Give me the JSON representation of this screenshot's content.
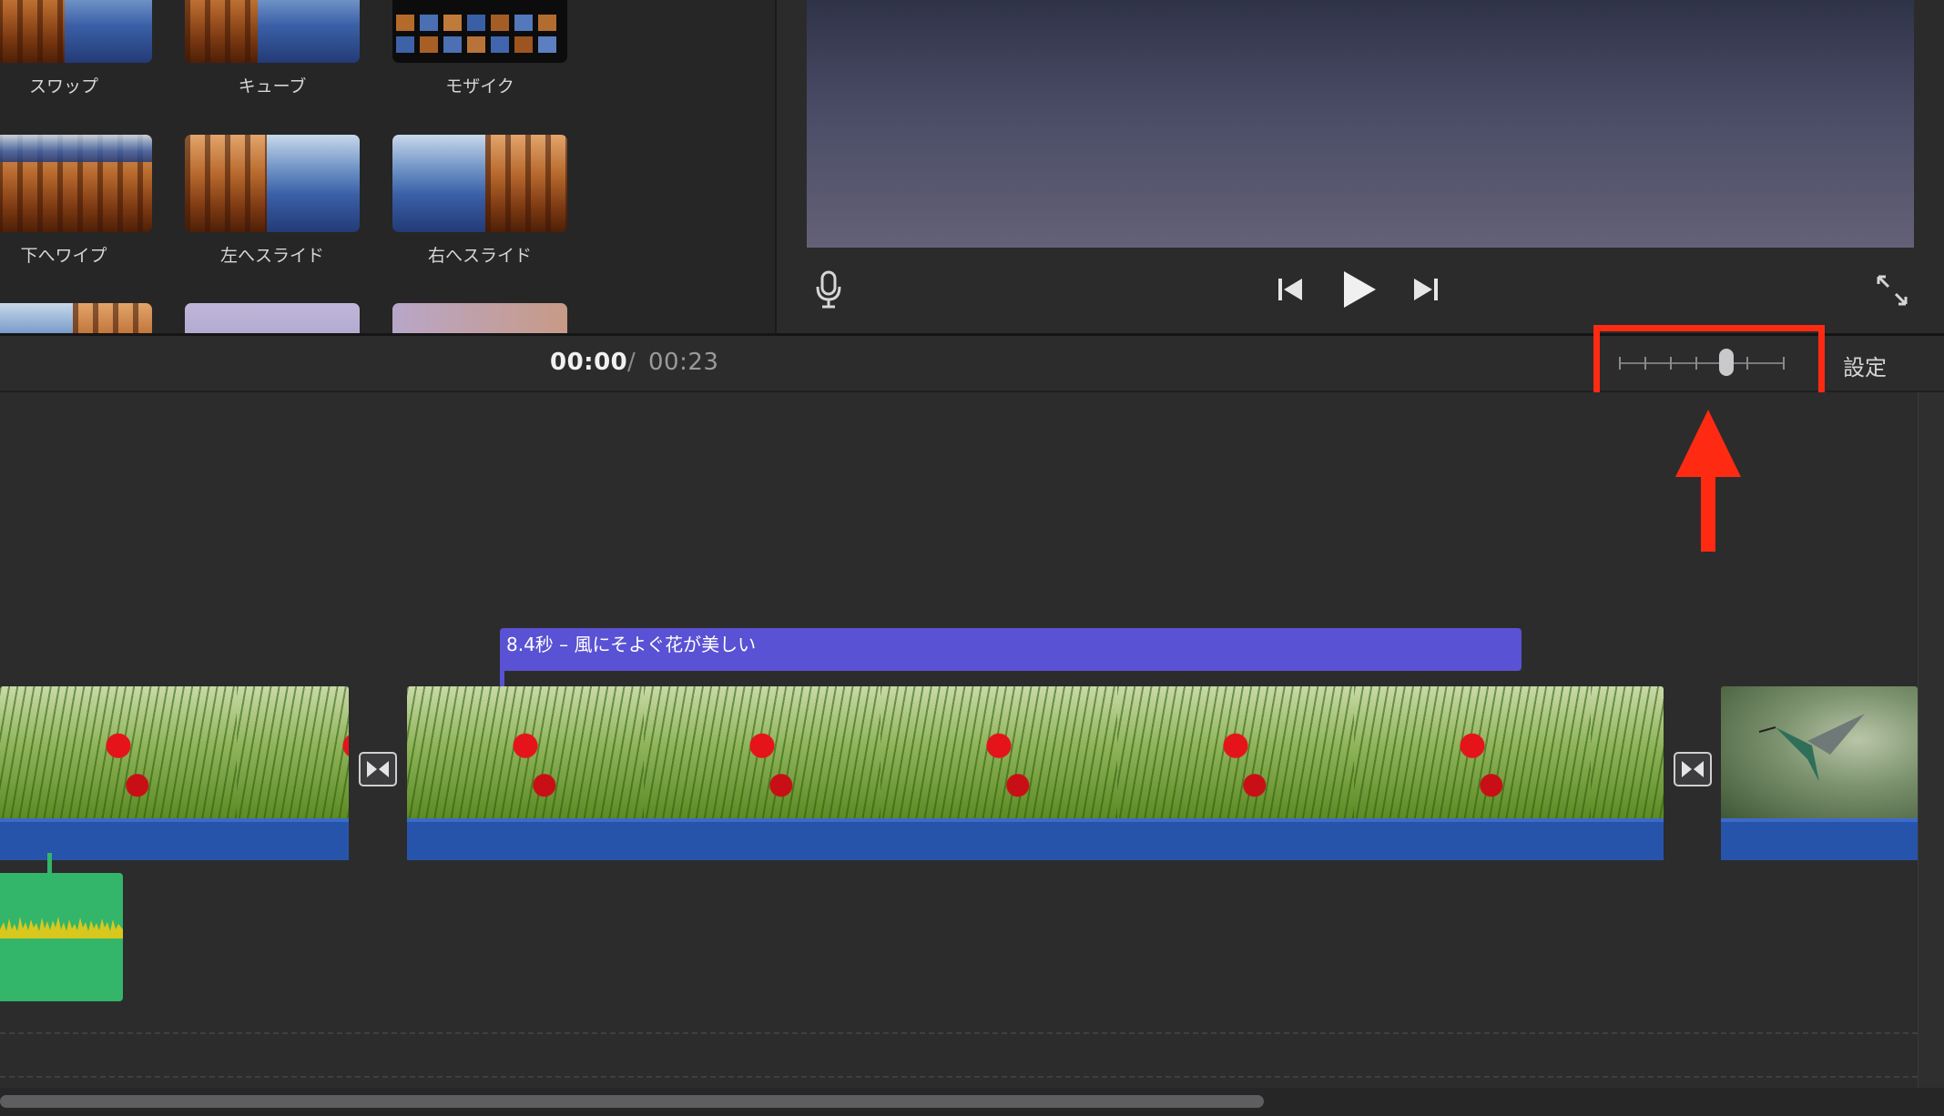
{
  "transitions": [
    {
      "label": "スワップ",
      "icon": "swap-transition-thumbnail"
    },
    {
      "label": "キューブ",
      "icon": "cube-transition-thumbnail"
    },
    {
      "label": "モザイク",
      "icon": "mosaic-transition-thumbnail"
    },
    {
      "label": "下へワイプ",
      "icon": "wipe-down-transition-thumbnail"
    },
    {
      "label": "左へスライド",
      "icon": "slide-left-transition-thumbnail"
    },
    {
      "label": "右へスライド",
      "icon": "slide-right-transition-thumbnail"
    }
  ],
  "viewer": {
    "controls": [
      "microphone-icon",
      "skip-back-icon",
      "play-icon",
      "skip-forward-icon",
      "fullscreen-icon"
    ]
  },
  "timecode": {
    "current": "00:00",
    "separator": "/",
    "total": "00:23"
  },
  "toolbar": {
    "settings_label": "設定",
    "zoom_slider_level": 0.65
  },
  "timeline": {
    "title_clip_label": "8.4秒 – 風にそよぐ花が美しい",
    "clips": [
      "flower-clip",
      "flower-clip",
      "hummingbird-clip"
    ],
    "transition_icon": "bowtie-transition-icon"
  },
  "annotation": {
    "highlight_color": "#ff2a12"
  }
}
